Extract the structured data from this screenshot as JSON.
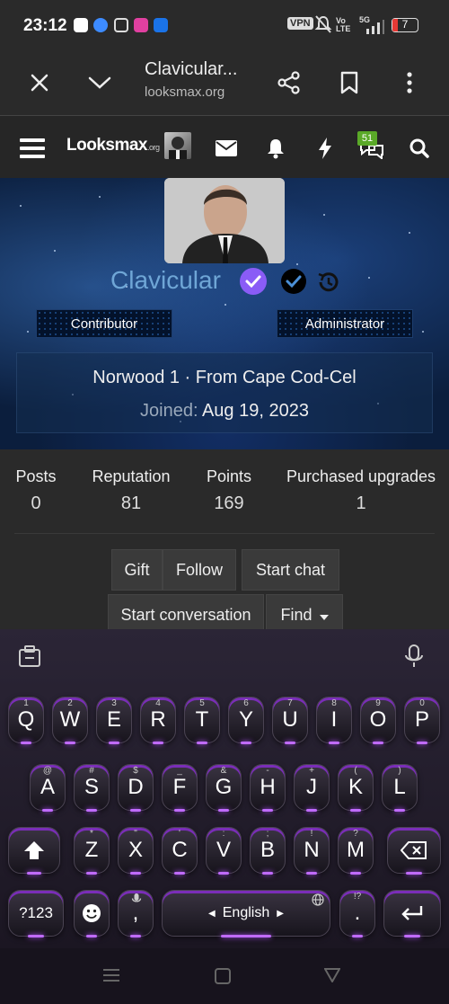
{
  "status_bar": {
    "time": "23:12",
    "vpn": "VPN",
    "volte": "Vo LTE",
    "network": "5G",
    "battery": "7"
  },
  "browser": {
    "page_title": "Clavicular...",
    "url": "looksmax.org",
    "icons": [
      "close-icon",
      "chevron-down-icon",
      "share-icon",
      "bookmark-icon",
      "more-vert-icon"
    ]
  },
  "site_nav": {
    "logo_main": "Looksmax",
    "logo_suffix": ".org",
    "alerts_badge": "51"
  },
  "profile": {
    "username": "Clavicular",
    "roles": [
      "Contributor",
      "Administrator"
    ],
    "location_line": "Norwood 1 · From Cape Cod-Cel",
    "joined_label": "Joined:",
    "joined_date": "Aug 19, 2023"
  },
  "stats": [
    {
      "label": "Posts",
      "value": "0"
    },
    {
      "label": "Reputation",
      "value": "81"
    },
    {
      "label": "Points",
      "value": "169"
    },
    {
      "label": "Purchased upgrades",
      "value": "1"
    }
  ],
  "actions": {
    "gift": "Gift",
    "follow": "Follow",
    "start_chat": "Start chat",
    "start_conversation": "Start conversation",
    "find": "Find"
  },
  "keyboard": {
    "row1": [
      [
        "Q",
        "1"
      ],
      [
        "W",
        "2"
      ],
      [
        "E",
        "3"
      ],
      [
        "R",
        "4"
      ],
      [
        "T",
        "5"
      ],
      [
        "Y",
        "6"
      ],
      [
        "U",
        "7"
      ],
      [
        "I",
        "8"
      ],
      [
        "O",
        "9"
      ],
      [
        "P",
        "0"
      ]
    ],
    "row2": [
      [
        "A",
        "@"
      ],
      [
        "S",
        "#"
      ],
      [
        "D",
        "$"
      ],
      [
        "F",
        "_"
      ],
      [
        "G",
        "&"
      ],
      [
        "H",
        "-"
      ],
      [
        "J",
        "+"
      ],
      [
        "K",
        "("
      ],
      [
        "L",
        ")"
      ]
    ],
    "row3": [
      [
        "Z",
        "*"
      ],
      [
        "X",
        "\""
      ],
      [
        "C",
        "'"
      ],
      [
        "V",
        ":"
      ],
      [
        "B",
        ";"
      ],
      [
        "N",
        "!"
      ],
      [
        "M",
        "?"
      ]
    ],
    "symbols_key": "?123",
    "comma": ",",
    "period": ".",
    "period_hint": "!?",
    "space_label": "English",
    "accent": "#b455ff"
  }
}
